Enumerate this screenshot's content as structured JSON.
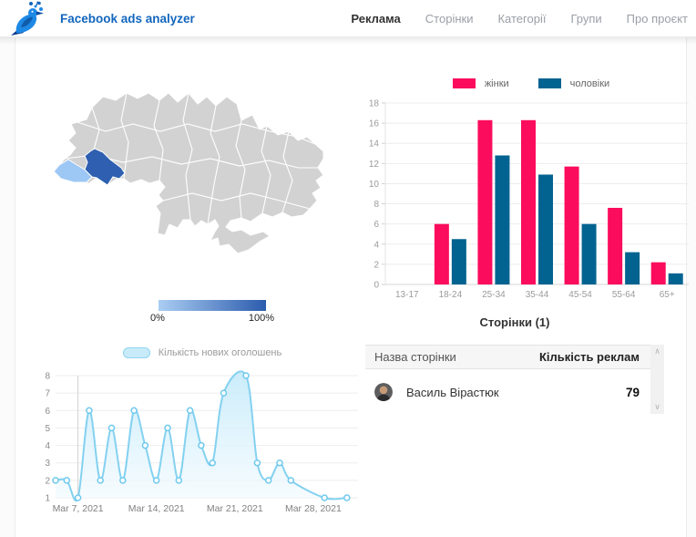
{
  "navbar": {
    "brand": "Facebook ads analyzer",
    "items": [
      {
        "label": "Реклама",
        "active": true
      },
      {
        "label": "Сторінки",
        "active": false
      },
      {
        "label": "Категорії",
        "active": false
      },
      {
        "label": "Групи",
        "active": false
      },
      {
        "label": "Про проєкт",
        "active": false
      }
    ]
  },
  "map": {
    "legend": {
      "min_label": "0%",
      "max_label": "100%",
      "gradient_from": "#abcdf3",
      "gradient_to": "#2b5cad"
    },
    "regions": {
      "base_fill": "#d2d2d2",
      "border": "#ffffff",
      "highlight_primary": "#2e5fb0",
      "highlight_secondary": "#9dc7f4"
    }
  },
  "chart_data": [
    {
      "type": "bar",
      "title": "",
      "categories": [
        "13-17",
        "18-24",
        "25-34",
        "35-44",
        "45-54",
        "55-64",
        "65+"
      ],
      "series": [
        {
          "name": "жінки",
          "color": "#fb0c5d",
          "values": [
            0,
            6,
            16.3,
            16.3,
            11.7,
            7.6,
            2.2
          ]
        },
        {
          "name": "чоловіки",
          "color": "#036390",
          "values": [
            0,
            4.5,
            12.8,
            10.9,
            6,
            3.2,
            1.1
          ]
        }
      ],
      "ylim": [
        0,
        18
      ],
      "ytick_step": 2,
      "legend_position": "top",
      "grid": true
    },
    {
      "type": "area",
      "legend": "Кількість нових оголошень",
      "line_color": "#84d1f0",
      "fill_from": "#c7ebfa",
      "fill_to": "#f4fbff",
      "ylim": [
        1,
        8
      ],
      "ytick_step": 1,
      "x_ticks": [
        {
          "pos": 2,
          "label": "Mar 7, 2021"
        },
        {
          "pos": 9,
          "label": "Mar 14, 2021"
        },
        {
          "pos": 16,
          "label": "Mar 21, 2021"
        },
        {
          "pos": 23,
          "label": "Mar 28, 2021"
        }
      ],
      "points": [
        [
          0,
          2
        ],
        [
          1,
          2
        ],
        [
          2,
          1
        ],
        [
          3,
          6
        ],
        [
          4,
          2
        ],
        [
          5,
          5
        ],
        [
          6,
          2
        ],
        [
          7,
          6
        ],
        [
          8,
          4
        ],
        [
          9,
          2
        ],
        [
          10,
          5
        ],
        [
          11,
          2
        ],
        [
          12,
          6
        ],
        [
          13,
          4
        ],
        [
          14,
          3
        ],
        [
          15,
          7
        ],
        [
          17,
          8
        ],
        [
          18,
          3
        ],
        [
          19,
          2
        ],
        [
          20,
          3
        ],
        [
          21,
          2
        ],
        [
          24,
          1
        ],
        [
          26,
          1
        ]
      ],
      "grid": true
    }
  ],
  "pages_section": {
    "title": "Сторінки (1)",
    "table": {
      "columns": [
        "Назва сторінки",
        "Кількість реклам"
      ],
      "rows": [
        {
          "name": "Василь Вірастюк",
          "ads_count": "79"
        }
      ]
    }
  },
  "icons": {
    "scroll_up": "∧",
    "scroll_down": "∨"
  }
}
